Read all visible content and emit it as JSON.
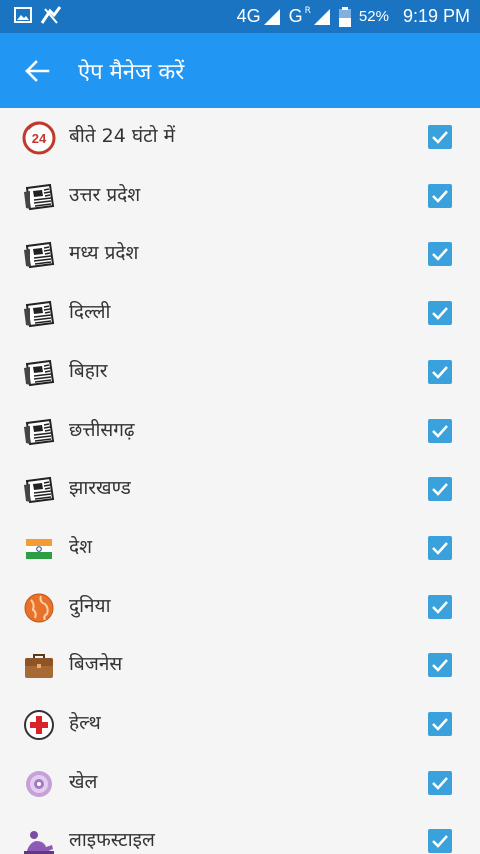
{
  "status_bar": {
    "network_4g": "4G",
    "network_g": "G",
    "network_g_sup": "R",
    "battery": "52%",
    "time": "9:19 PM"
  },
  "app_bar": {
    "title": "ऐप मैनेज करें",
    "back_icon": "arrow-left-icon"
  },
  "colors": {
    "status_bar": "#1a74c2",
    "app_bar": "#2196f3",
    "checkbox": "#3ba1dc",
    "background": "#f5f5f5"
  },
  "items": [
    {
      "label": "बीते 24 घंटो में",
      "icon": "24-hours-icon",
      "badge": "24",
      "checked": true
    },
    {
      "label": "उत्तर प्रदेश",
      "icon": "newspaper-icon",
      "checked": true
    },
    {
      "label": "मध्य प्रदेश",
      "icon": "newspaper-icon",
      "checked": true
    },
    {
      "label": "दिल्ली",
      "icon": "newspaper-icon",
      "checked": true
    },
    {
      "label": "बिहार",
      "icon": "newspaper-icon",
      "checked": true
    },
    {
      "label": "छत्तीसगढ़",
      "icon": "newspaper-icon",
      "checked": true
    },
    {
      "label": "झारखण्ड",
      "icon": "newspaper-icon",
      "checked": true
    },
    {
      "label": "देश",
      "icon": "india-flag-icon",
      "checked": true
    },
    {
      "label": "दुनिया",
      "icon": "globe-icon",
      "checked": true
    },
    {
      "label": "बिजनेस",
      "icon": "briefcase-icon",
      "checked": true
    },
    {
      "label": "हेल्थ",
      "icon": "health-cross-icon",
      "checked": true
    },
    {
      "label": "खेल",
      "icon": "ball-icon",
      "checked": true
    },
    {
      "label": "लाइफस्टाइल",
      "icon": "lifestyle-icon",
      "checked": true
    }
  ]
}
